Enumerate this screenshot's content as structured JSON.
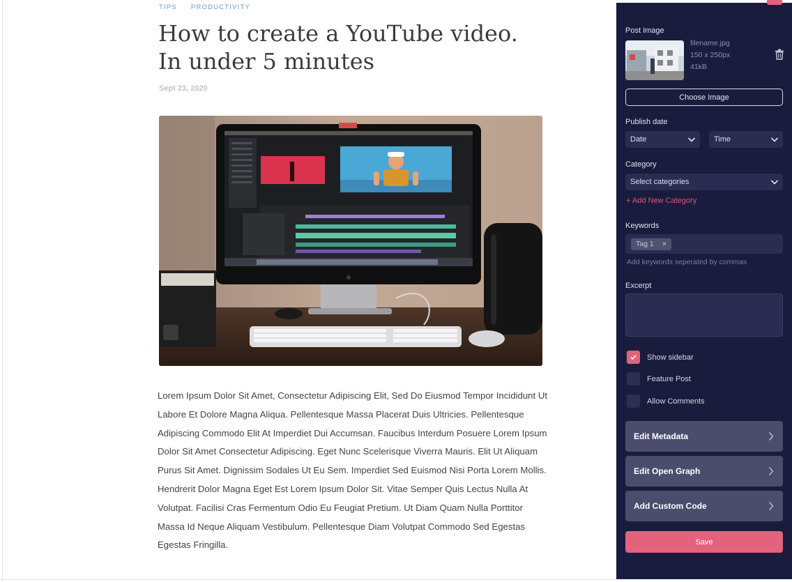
{
  "article": {
    "tags": [
      "TIPS",
      "PRODUCTIVITY"
    ],
    "title_line1": "How to create a YouTube video.",
    "title_line2": "In under 5 minutes",
    "date": "Sept 23, 2020",
    "body": "Lorem Ipsum Dolor Sit Amet, Consectetur Adipiscing Elit, Sed Do Eiusmod Tempor Incididunt Ut Labore Et Dolore Magna Aliqua. Pellentesque Massa Placerat Duis Ultricies. Pellentesque Adipiscing Commodo Elit At Imperdiet Dui Accumsan. Faucibus Interdum Posuere Lorem Ipsum Dolor Sit Amet Consectetur Adipiscing. Eget Nunc Scelerisque Viverra Mauris. Elit Ut Aliquam Purus Sit Amet. Dignissim Sodales Ut Eu Sem. Imperdiet Sed Euismod Nisi Porta Lorem Mollis. Hendrerit Dolor Magna Eget Est Lorem Ipsum Dolor Sit. Vitae Semper Quis Lectus Nulla At Volutpat. Facilisi Cras Fermentum Odio Eu Feugiat Pretium. Ut Diam Quam Nulla Porttitor Massa Id Neque Aliquam Vestibulum. Pellentesque Diam Volutpat Commodo Sed Egestas Egestas Fringilla."
  },
  "sidebar": {
    "post_image_label": "Post Image",
    "file_name": "filename.jpg",
    "file_dims": "150 x 250px",
    "file_size": "41kB",
    "choose_image_label": "Choose Image",
    "publish_date_label": "Publish date",
    "date_select": "Date",
    "time_select": "Time",
    "category_label": "Category",
    "category_select": "Select categories",
    "add_category": "+ Add New Category",
    "keywords_label": "Keywords",
    "tag1": "Tag 1",
    "tag_remove": "×",
    "keywords_hint": "Add keywords seperated by commas",
    "excerpt_label": "Excerpt",
    "checkboxes": [
      {
        "label": "Show sidebar",
        "checked": true
      },
      {
        "label": "Feature Post",
        "checked": false
      },
      {
        "label": "Allow Comments",
        "checked": false
      }
    ],
    "accordions": [
      "Edit Metadata",
      "Edit Open Graph",
      "Add Custom Code"
    ],
    "save_label": "Save"
  },
  "icons": [
    "trash-icon",
    "chevron-down-icon",
    "chevron-right-icon",
    "check-icon"
  ],
  "colors": {
    "sidebar_bg": "#1a1c3d",
    "field_bg": "#2a2c52",
    "accent_pink": "#e3627c",
    "accordion_bg": "#4b4d6c",
    "tag_link": "#6f95cf"
  }
}
